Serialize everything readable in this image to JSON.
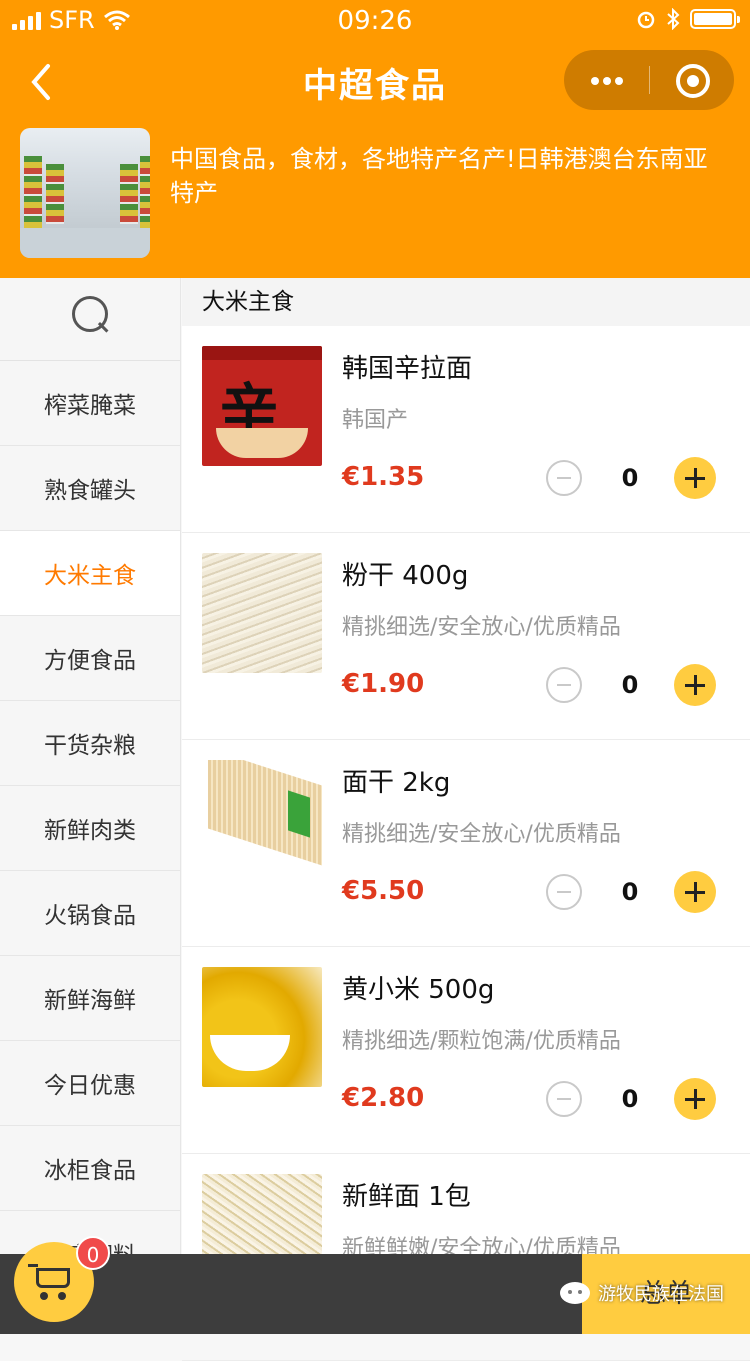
{
  "status_bar": {
    "carrier": "SFR",
    "time": "09:26"
  },
  "nav": {
    "title": "中超食品"
  },
  "shop": {
    "description": "中国食品，食材，各地特产名产!日韩港澳台东南亚特产"
  },
  "sidebar": {
    "categories": [
      {
        "label": "榨菜腌菜",
        "active": false
      },
      {
        "label": "熟食罐头",
        "active": false
      },
      {
        "label": "大米主食",
        "active": true
      },
      {
        "label": "方便食品",
        "active": false
      },
      {
        "label": "干货杂粮",
        "active": false
      },
      {
        "label": "新鲜肉类",
        "active": false
      },
      {
        "label": "火锅食品",
        "active": false
      },
      {
        "label": "新鲜海鲜",
        "active": false
      },
      {
        "label": "今日优惠",
        "active": false
      },
      {
        "label": "冰柜食品",
        "active": false
      },
      {
        "label": "厨房调料",
        "active": false
      }
    ]
  },
  "section": {
    "title": "大米主食"
  },
  "products": [
    {
      "name": "韩国辛拉面",
      "desc": "韩国产",
      "price": "€1.35",
      "qty": "0",
      "thumb_text": "辛"
    },
    {
      "name": "粉干 400g",
      "desc": "精挑细选/安全放心/优质精品",
      "price": "€1.90",
      "qty": "0"
    },
    {
      "name": "面干 2kg",
      "desc": "精挑细选/安全放心/优质精品",
      "price": "€5.50",
      "qty": "0"
    },
    {
      "name": "黄小米 500g",
      "desc": "精挑细选/颗粒饱满/优质精品",
      "price": "€2.80",
      "qty": "0"
    },
    {
      "name": "新鲜面 1包",
      "desc": "新鲜鲜嫩/安全放心/优质精品",
      "price": "",
      "qty": ""
    }
  ],
  "cart": {
    "count": "0",
    "checkout_label": "总单"
  },
  "watermark": {
    "text": "游牧民族在法国"
  },
  "colors": {
    "brand": "#ff9a00",
    "price": "#e03a1e",
    "accent": "#ffcc40",
    "active_category": "#ff7a00"
  }
}
